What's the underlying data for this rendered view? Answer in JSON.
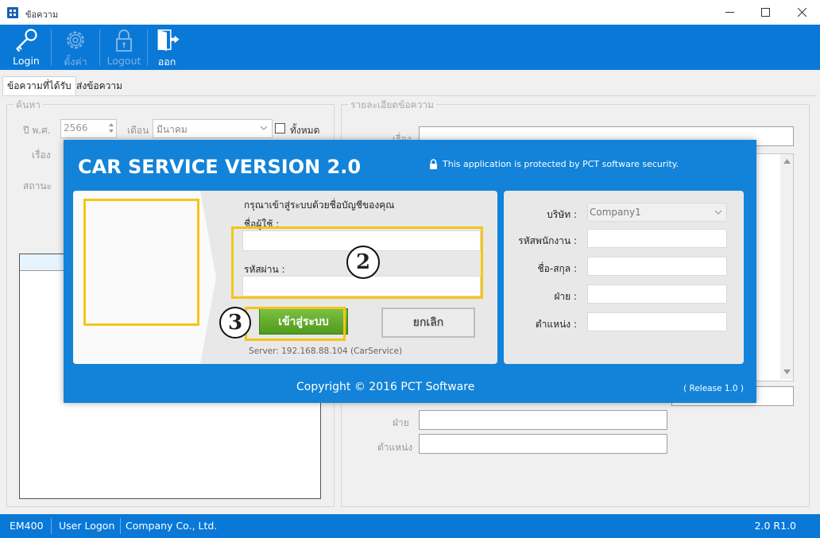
{
  "window": {
    "title": "ข้อความ"
  },
  "toolbar": {
    "login": "Login",
    "settings": "ตั้งค่า",
    "logout": "Logout",
    "exit": "ออก"
  },
  "tabs": [
    {
      "label": "ข้อความที่ได้รับ",
      "active": true
    },
    {
      "label": "ส่งข้อความ",
      "active": false
    }
  ],
  "search": {
    "group_label": "ค้นหา",
    "year_label": "ปี พ.ศ.",
    "year_value": "2566",
    "month_label": "เดือน",
    "month_value": "มีนาคม",
    "all_label": "ทั้งหมด",
    "subject_label": "เรื่อง",
    "status_label": "สถานะ"
  },
  "detail": {
    "group_label": "รายละเอียดข้อความ",
    "subject_label": "เรื่อง",
    "department_label": "ฝ่าย",
    "position_label": "ตำแหน่ง"
  },
  "dialog": {
    "title": "CAR SERVICE VERSION 2.0",
    "security_note": "This application is protected by PCT software security.",
    "prompt": "กรุณาเข้าสู่ระบบด้วยชื่อบัญชีของคุณ",
    "username_label": "ชื่อผู้ใช้ :",
    "password_label": "รหัสผ่าน :",
    "login_button": "เข้าสู่ระบบ",
    "cancel_button": "ยกเลิก",
    "server": "Server: 192.168.88.104 (CarService)",
    "company_label": "บริษัท :",
    "company_value": "Company1",
    "employee_id_label": "รหัสพนักงาน :",
    "fullname_label": "ชื่อ-สกุล :",
    "department_label": "ฝ่าย :",
    "position_label": "ตำแหน่ง :",
    "copyright": "Copyright © 2016 PCT Software",
    "release": "( Release 1.0 )"
  },
  "annotations": {
    "step2": "2",
    "step3": "3"
  },
  "statusbar": {
    "code": "EM400",
    "user": "User Logon",
    "company": "Company Co., Ltd.",
    "version": "2.0 R1.0"
  },
  "colors": {
    "accent": "#0a78d7",
    "dialog": "#1283d8",
    "highlight": "#f5c518",
    "login_green": "#5aa324"
  }
}
